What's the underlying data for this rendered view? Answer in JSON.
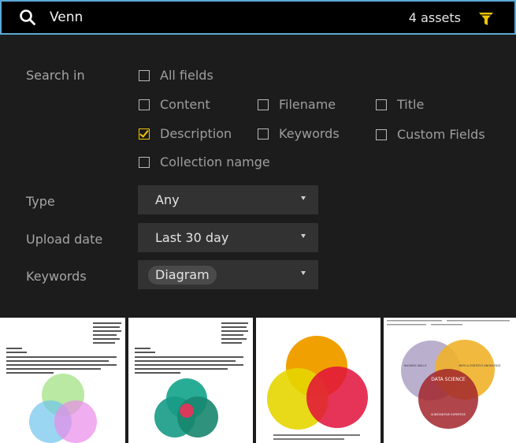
{
  "search": {
    "query": "Venn",
    "asset_count": "4 assets",
    "icon": "search-icon",
    "filter_icon": "funnel-icon",
    "accent": "#f3c400",
    "border_color": "#5aa9d6"
  },
  "filters": {
    "search_in_label": "Search in",
    "fields": [
      {
        "label": "All fields",
        "checked": false
      },
      {
        "label": "Content",
        "checked": false
      },
      {
        "label": "Filename",
        "checked": false
      },
      {
        "label": "Title",
        "checked": false
      },
      {
        "label": "Description",
        "checked": true
      },
      {
        "label": "Keywords",
        "checked": false
      },
      {
        "label": "Custom Fields",
        "checked": false
      },
      {
        "label": "Collection namge",
        "checked": false
      }
    ],
    "type": {
      "label": "Type",
      "value": "Any"
    },
    "upload_date": {
      "label": "Upload date",
      "value": "Last 30 day"
    },
    "keywords": {
      "label": "Keywords",
      "chip": "Diagram"
    }
  },
  "results": {
    "thumbnails": [
      {
        "name": "document-venn-three-circles"
      },
      {
        "name": "document-venn-teal"
      },
      {
        "name": "venn-yellow-orange-red"
      },
      {
        "name": "data-science-venn"
      }
    ],
    "data_science_labels": {
      "center": "DATA SCIENCE",
      "left": "HACKING SKILLS",
      "right": "MATH & STATISTICS KNOWLEDGE",
      "bottom": "SUBSTANTIVE EXPERTISE"
    }
  }
}
